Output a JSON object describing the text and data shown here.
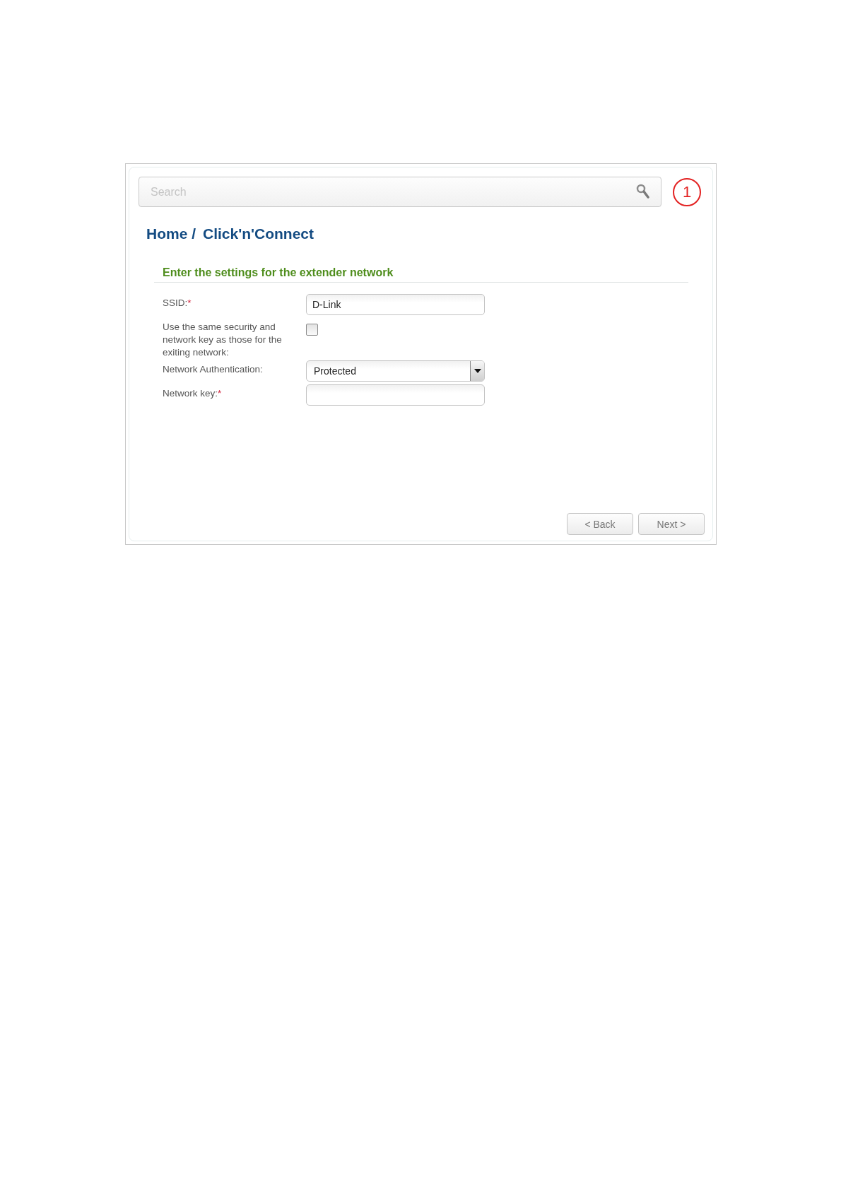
{
  "search": {
    "placeholder": "Search"
  },
  "callout": "1",
  "breadcrumb": [
    "Home /",
    "Click'n'Connect"
  ],
  "section_title": "Enter the settings for the extender network",
  "form": [
    {
      "kind": "text",
      "label": "SSID:",
      "required_mark": "*",
      "value": "D-Link"
    },
    {
      "kind": "checkbox",
      "label": "Use the same security and network key as those for the exiting network:",
      "checked": false
    },
    {
      "kind": "select",
      "label": "Network Authentication:",
      "value": "Protected"
    },
    {
      "kind": "text",
      "label": "Network key:",
      "required_mark": "*"
    }
  ],
  "buttons": [
    "< Back",
    "Next >"
  ]
}
